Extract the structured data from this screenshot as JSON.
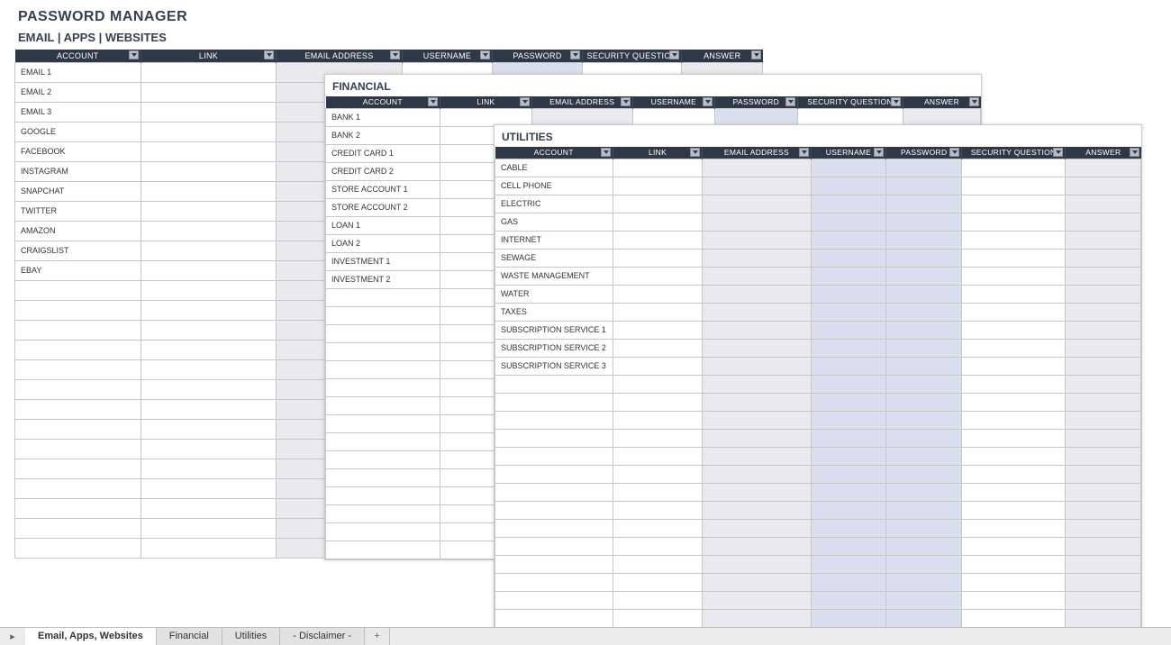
{
  "title": "PASSWORD MANAGER",
  "subtitle": "EMAIL | APPS | WEBSITES",
  "columns": {
    "account": "ACCOUNT",
    "link": "LINK",
    "email_address": "EMAIL ADDRESS",
    "username": "USERNAME",
    "password": "PASSWORD",
    "security_question": "SECURITY QUESTION",
    "answer": "ANSWER"
  },
  "sheets": {
    "email": {
      "rows": [
        "EMAIL 1",
        "EMAIL 2",
        "EMAIL 3",
        "GOOGLE",
        "FACEBOOK",
        "INSTAGRAM",
        "SNAPCHAT",
        "TWITTER",
        "AMAZON",
        "CRAIGSLIST",
        "EBAY"
      ],
      "empty_rows": 14
    },
    "financial": {
      "title": "FINANCIAL",
      "rows": [
        "BANK 1",
        "BANK 2",
        "CREDIT CARD 1",
        "CREDIT CARD 2",
        "STORE ACCOUNT 1",
        "STORE ACCOUNT 2",
        "LOAN 1",
        "LOAN 2",
        "INVESTMENT 1",
        "INVESTMENT 2"
      ],
      "empty_rows": 15
    },
    "utilities": {
      "title": "UTILITIES",
      "rows": [
        "CABLE",
        "CELL PHONE",
        "ELECTRIC",
        "GAS",
        "INTERNET",
        "SEWAGE",
        "WASTE MANAGEMENT",
        "WATER",
        "TAXES",
        "SUBSCRIPTION SERVICE 1",
        "SUBSCRIPTION SERVICE 2",
        "SUBSCRIPTION SERVICE 3"
      ],
      "empty_rows": 14
    }
  },
  "tabs": {
    "items": [
      "Email, Apps, Websites",
      "Financial",
      "Utilities",
      "- Disclaimer -"
    ],
    "active_index": 0,
    "add_label": "+"
  }
}
